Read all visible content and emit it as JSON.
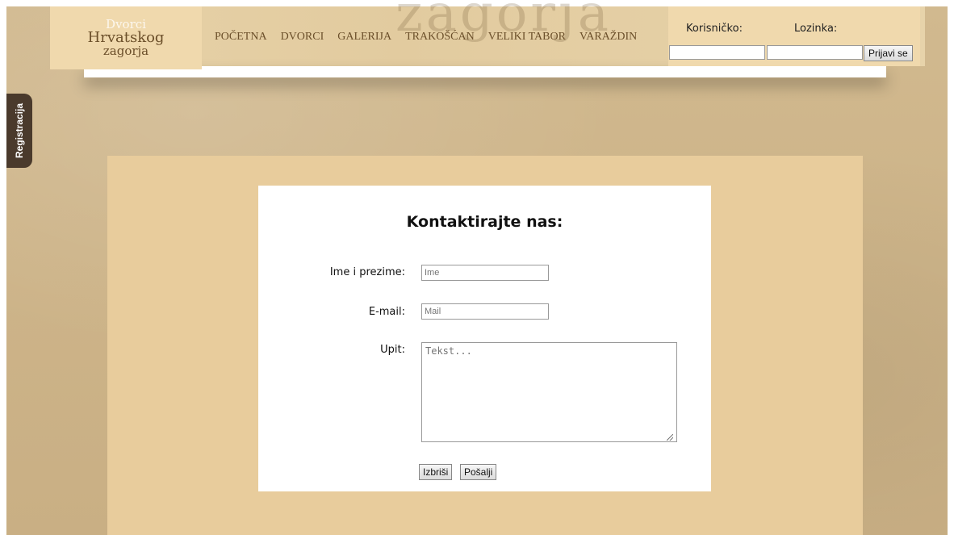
{
  "header": {
    "logo": {
      "line1": "Dvorci",
      "line2": "Hrvatskog",
      "line3": "zagorja"
    },
    "watermark": "zagorja",
    "nav": [
      {
        "label": "POČETNA"
      },
      {
        "label": "DVORCI"
      },
      {
        "label": "GALERIJA"
      },
      {
        "label": "TRAKOŠĆAN"
      },
      {
        "label": "VELIKI TABOR"
      },
      {
        "label": "VARAŽDIN"
      }
    ],
    "login": {
      "username_label": "Korisničko:",
      "password_label": "Lozinka:",
      "username_value": "",
      "password_value": "",
      "submit_label": "Prijavi se"
    }
  },
  "side_tab": {
    "label": "Registracija"
  },
  "form": {
    "title": "Kontaktirajte nas:",
    "name_label": "Ime i prezime:",
    "name_placeholder": "Ime",
    "email_label": "E-mail:",
    "email_placeholder": "Mail",
    "query_label": "Upit:",
    "query_placeholder": "Tekst...",
    "reset_label": "Izbriši",
    "submit_label": "Pošalji"
  },
  "colors": {
    "background": "#cdb389",
    "header": "#e4cea3",
    "panel": "#e8cc9c",
    "card": "#ffffff",
    "side_tab": "#4a3a2c",
    "nav_text": "#6b4f2a"
  }
}
